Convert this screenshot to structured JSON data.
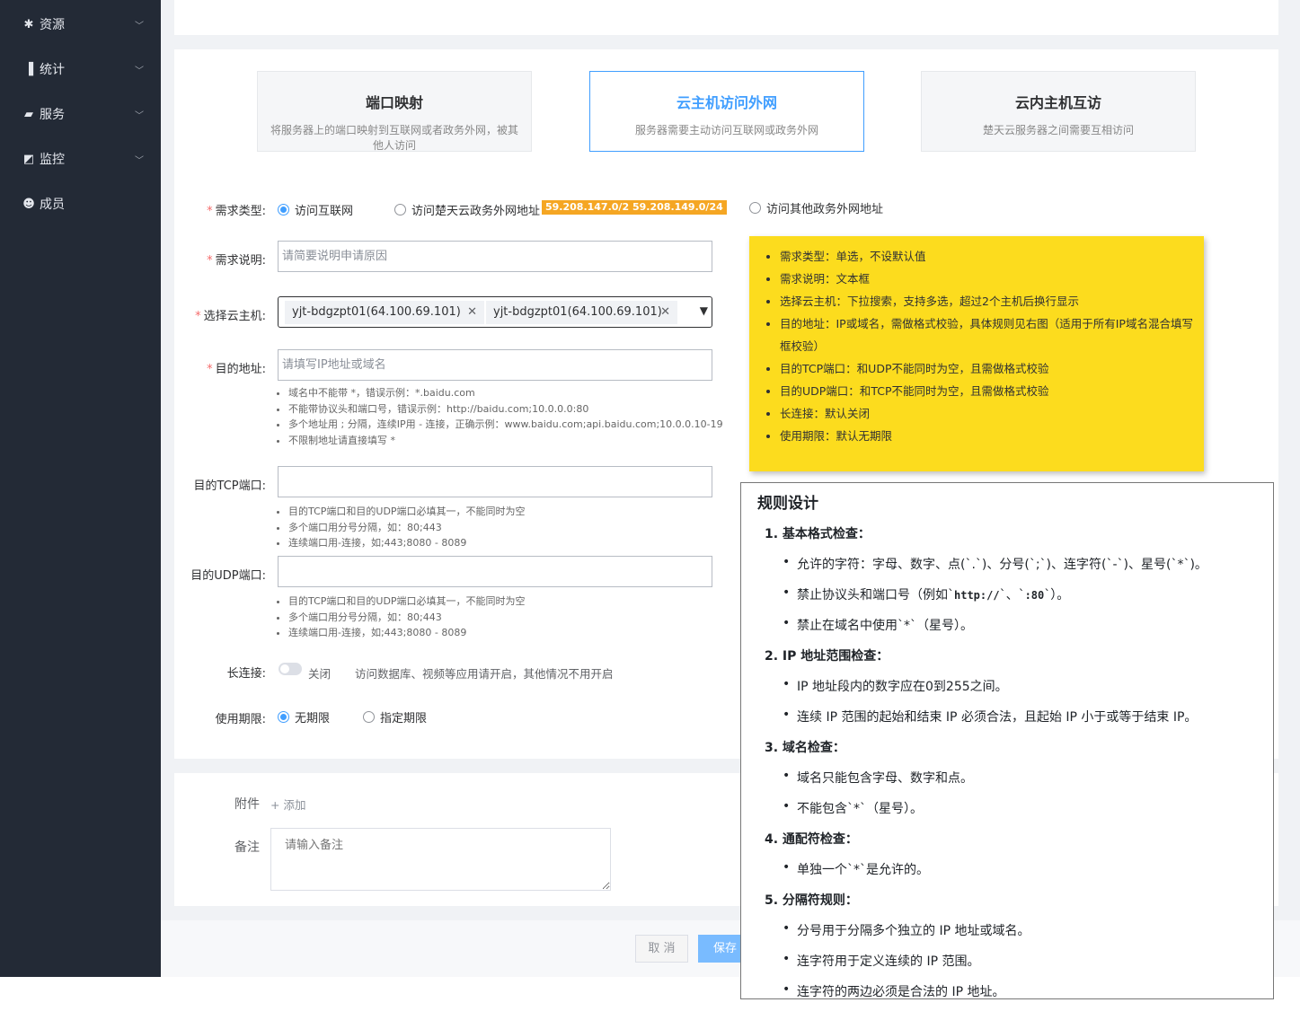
{
  "sidebar": {
    "items": [
      {
        "label": "资源",
        "icon": "resource-icon",
        "glyph": "✱",
        "expandable": true
      },
      {
        "label": "统计",
        "icon": "bar-chart-icon",
        "glyph": "▐",
        "expandable": true
      },
      {
        "label": "服务",
        "icon": "bookmark-icon",
        "glyph": "▰",
        "expandable": true
      },
      {
        "label": "监控",
        "icon": "monitor-icon",
        "glyph": "◩",
        "expandable": true
      },
      {
        "label": "成员",
        "icon": "user-icon",
        "glyph": "☻",
        "expandable": false
      }
    ],
    "chevron": "﹀"
  },
  "tabs": [
    {
      "title": "端口映射",
      "desc": "将服务器上的端口映射到互联网或者政务外网，被其他人访问",
      "active": false
    },
    {
      "title": "云主机访问外网",
      "desc": "服务器需要主动访问互联网或政务外网",
      "active": true
    },
    {
      "title": "云内主机互访",
      "desc": "楚天云服务器之间需要互相访问",
      "active": false
    }
  ],
  "form": {
    "type_label": "需求类型:",
    "type_options": [
      "访问互联网",
      "访问楚天云政务外网地址",
      "访问其他政务外网地址"
    ],
    "ip_badges": [
      "59.208.147.0/24",
      "59.208.149.0/24"
    ],
    "desc_label": "需求说明:",
    "desc_placeholder": "请简要说明申请原因",
    "host_label": "选择云主机:",
    "host_tags": [
      "yjt-bdgzpt01(64.100.69.101)",
      "yjt-bdgzpt01(64.100.69.101)"
    ],
    "dest_label": "目的地址:",
    "dest_placeholder": "请填写IP地址或域名",
    "dest_hints": [
      "域名中不能带 *，错误示例：*.baidu.com",
      "不能带协议头和端口号，错误示例：http://baidu.com;10.0.0.0:80",
      "多个地址用 ; 分隔，连续IP用 - 连接，正确示例：www.baidu.com;api.baidu.com;10.0.0.10-19",
      "不限制地址请直接填写 *"
    ],
    "tcp_label": "目的TCP端口:",
    "tcp_hints": [
      "目的TCP端口和目的UDP端口必填其一，不能同时为空",
      "多个端口用分号分隔，如：80;443",
      "连续端口用-连接，如;443;8080 - 8089"
    ],
    "udp_label": "目的UDP端口:",
    "udp_hints": [
      "目的TCP端口和目的UDP端口必填其一，不能同时为空",
      "多个端口用分号分隔，如：80;443",
      "连续端口用-连接，如;443;8080 - 8089"
    ],
    "keepalive_label": "长连接:",
    "keepalive_state": "关闭",
    "keepalive_hint": "访问数据库、视频等应用请开启，其他情况不用开启",
    "period_label": "使用期限:",
    "period_options": [
      "无期限",
      "指定期限"
    ]
  },
  "attach": {
    "label": "附件",
    "add": "+ 添加",
    "note_label": "备注",
    "note_placeholder": "请输入备注"
  },
  "buttons": {
    "cancel": "取 消",
    "save": "保存"
  },
  "sticky_note": {
    "items": [
      "需求类型：单选，不设默认值",
      "需求说明：文本框",
      "选择云主机：下拉搜索，支持多选，超过2个主机后换行显示",
      "目的地址：IP或域名，需做格式校验，具体规则见右图（适用于所有IP域名混合填写框校验）",
      "目的TCP端口：和UDP不能同时为空，且需做格式校验",
      "目的UDP端口：和TCP不能同时为空，且需做格式校验",
      "长连接：默认关闭",
      "使用期限：默认无期限"
    ]
  },
  "rules": {
    "title": "规则设计",
    "s1": "1.  基本格式检查：",
    "s1a": "允许的字符：字母、数字、点(`.`)、分号(`;`)、连字符(`-`)、星号(`*`)。",
    "s1b_pre": "禁止协议头和端口号（例如`",
    "s1b_code1": "http://",
    "s1b_mid": "`、`",
    "s1b_code2": ":80",
    "s1b_post": "`）。",
    "s1c": "禁止在域名中使用`*`（星号）。",
    "s2": "2.  IP 地址范围检查：",
    "s2a": "IP 地址段内的数字应在0到255之间。",
    "s2b": "连续 IP 范围的起始和结束 IP 必须合法，且起始 IP 小于或等于结束 IP。",
    "s3": "3.  域名检查：",
    "s3a": "域名只能包含字母、数字和点。",
    "s3b": "不能包含`*`（星号）。",
    "s4": "4.  通配符检查：",
    "s4a": "单独一个`*`是允许的。",
    "s5": "5.  分隔符规则：",
    "s5a": "分号用于分隔多个独立的 IP 地址或域名。",
    "s5b": "连字符用于定义连续的 IP 范围。",
    "s5c": "连字符的两边必须是合法的 IP 地址。"
  }
}
